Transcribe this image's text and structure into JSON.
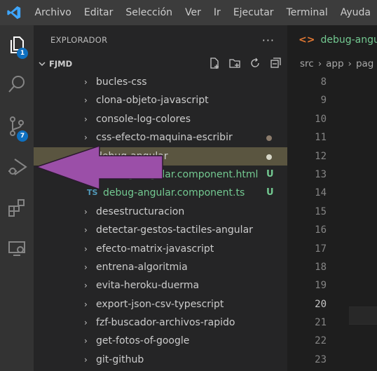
{
  "menubar": {
    "logo": "vscode-logo",
    "items": [
      "Archivo",
      "Editar",
      "Selección",
      "Ver",
      "Ir",
      "Ejecutar",
      "Terminal",
      "Ayuda"
    ]
  },
  "activitybar": {
    "explorer_badge": "1",
    "source_control_badge": "7",
    "badge_color": "#0e70c0"
  },
  "sidebar": {
    "title": "EXPLORADOR",
    "more": "···",
    "section_title": "FJMD",
    "tree": [
      {
        "label": "bucles-css",
        "type": "folder"
      },
      {
        "label": "clona-objeto-javascript",
        "type": "folder"
      },
      {
        "label": "console-log-colores",
        "type": "folder"
      },
      {
        "label": "css-efecto-maquina-escribir",
        "type": "folder",
        "status": "dot"
      },
      {
        "label": "debug-angular",
        "type": "folder",
        "status": "dot",
        "selected": true
      },
      {
        "label": "debug-angular.component.html",
        "type": "file",
        "status": "U"
      },
      {
        "label": "debug-angular.component.ts",
        "type": "file",
        "icon": "TS",
        "status": "U"
      },
      {
        "label": "desestructuracion",
        "type": "folder"
      },
      {
        "label": "detectar-gestos-tactiles-angular",
        "type": "folder"
      },
      {
        "label": "efecto-matrix-javascript",
        "type": "folder"
      },
      {
        "label": "entrena-algoritmia",
        "type": "folder"
      },
      {
        "label": "evita-heroku-duerma",
        "type": "folder"
      },
      {
        "label": "export-json-csv-typescript",
        "type": "folder"
      },
      {
        "label": "fzf-buscador-archivos-rapido",
        "type": "folder"
      },
      {
        "label": "get-fotos-of-google",
        "type": "folder"
      },
      {
        "label": "git-github",
        "type": "folder"
      }
    ]
  },
  "editor": {
    "tab_icon": "<>",
    "tab_label": "debug-angular",
    "breadcrumb": [
      "src",
      "app",
      "pag"
    ],
    "line_numbers": [
      "8",
      "9",
      "10",
      "11",
      "12",
      "13",
      "14",
      "15",
      "16",
      "17",
      "18",
      "19",
      "20",
      "21",
      "22",
      "23"
    ],
    "current_line": "20"
  },
  "colors": {
    "arrow": "#9b4fa8",
    "untracked": "#73c991",
    "selection": "#5a5540"
  }
}
